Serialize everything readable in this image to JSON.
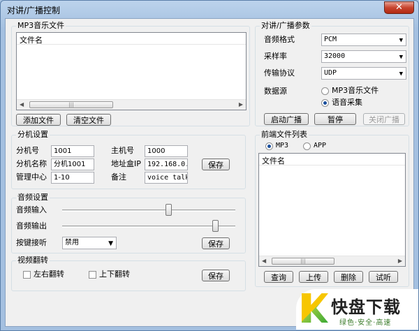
{
  "window": {
    "title": "对讲/广播控制",
    "close_glyph": "✕"
  },
  "mp3_group": {
    "title": "MP3音乐文件",
    "column_header": "文件名",
    "scroll_grip": "|||",
    "add_button": "添加文件",
    "clear_button": "清空文件"
  },
  "params_group": {
    "title": "对讲/广播参数",
    "audio_format_label": "音频格式",
    "audio_format_value": "PCM",
    "sample_rate_label": "采样率",
    "sample_rate_value": "32000",
    "protocol_label": "传输协议",
    "protocol_value": "UDP",
    "source_label": "数据源",
    "source_options": [
      "MP3音乐文件",
      "语音采集"
    ],
    "source_selected": "语音采集",
    "start_button": "启动广播",
    "pause_button": "暂停",
    "stop_button": "关闭广播"
  },
  "extension_group": {
    "title": "分机设置",
    "ext_no_label": "分机号",
    "ext_no_value": "1001",
    "host_no_label": "主机号",
    "host_no_value": "1000",
    "ext_name_label": "分机名称",
    "ext_name_value": "分机1001",
    "ip_label": "地址盒IP",
    "ip_value": "192.168.0.1",
    "center_label": "管理中心",
    "center_value": "1-10",
    "note_label": "备注",
    "note_value": "voice talk",
    "save_button": "保存"
  },
  "audio_group": {
    "title": "音频设置",
    "input_label": "音频输入",
    "input_level": 0.62,
    "output_label": "音频输出",
    "output_level": 0.9,
    "monitor_label": "按键接听",
    "monitor_value": "禁用",
    "save_button": "保存"
  },
  "video_group": {
    "title": "视频翻转",
    "flip_h_label": "左右翻转",
    "flip_h_checked": false,
    "flip_v_label": "上下翻转",
    "flip_v_checked": false,
    "save_button": "保存"
  },
  "frontend_group": {
    "title": "前端文件列表",
    "type_options": [
      "MP3",
      "APP"
    ],
    "type_selected": "MP3",
    "column_header": "文件名",
    "scroll_grip": "|||",
    "query_button": "查询",
    "upload_button": "上传",
    "delete_button": "删除",
    "listen_button": "试听"
  },
  "watermark": {
    "main": "快盘下载",
    "sub": "绿色·安全·高速"
  },
  "icons": {
    "close": "close-icon",
    "dropdown": "chevron-down-icon",
    "scroll_left": "scroll-left-icon",
    "scroll_right": "scroll-right-icon"
  }
}
